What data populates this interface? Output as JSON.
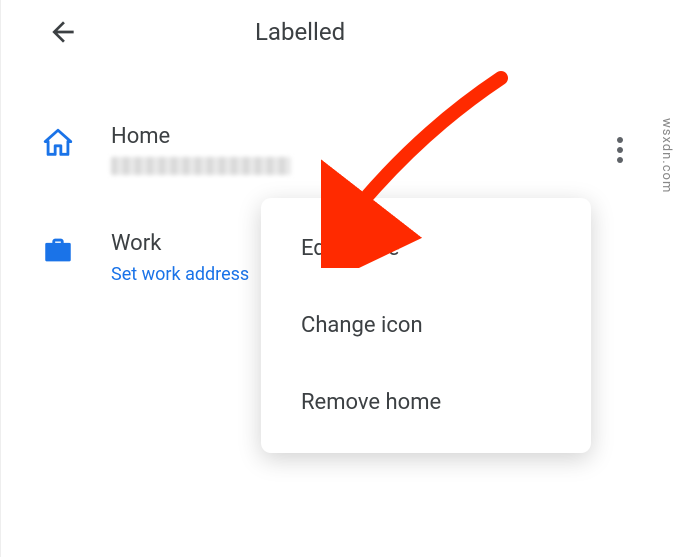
{
  "header": {
    "title": "Labelled"
  },
  "items": [
    {
      "label": "Home",
      "subtext": "",
      "blurred": true,
      "link": "",
      "has_more": true
    },
    {
      "label": "Work",
      "subtext": "",
      "blurred": false,
      "link": "Set work address",
      "has_more": false
    }
  ],
  "popup": {
    "options": [
      "Edit home",
      "Change icon",
      "Remove home"
    ]
  },
  "watermark": "wsxdn.com",
  "colors": {
    "accent": "#1a73e8",
    "text": "#3c4043",
    "arrow": "#ff2a00"
  }
}
